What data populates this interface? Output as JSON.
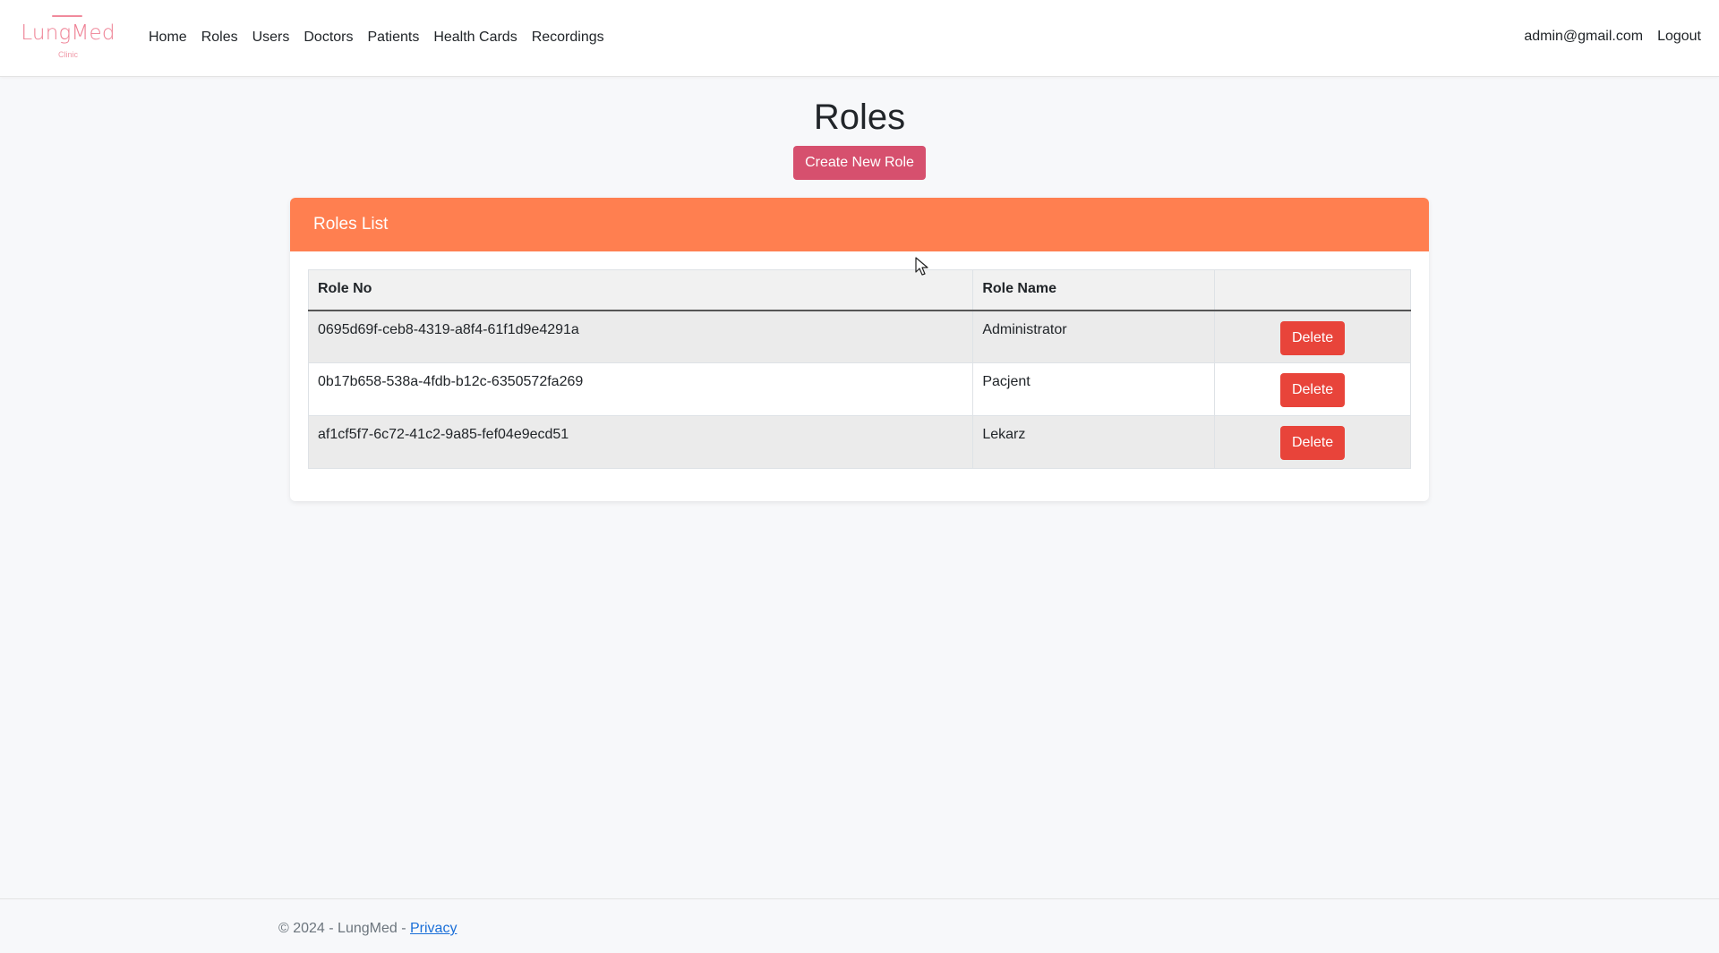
{
  "brand": {
    "name": "LungMed",
    "subtitle": "Clinic"
  },
  "nav": {
    "links": [
      "Home",
      "Roles",
      "Users",
      "Doctors",
      "Patients",
      "Health Cards",
      "Recordings"
    ],
    "user_email": "admin@gmail.com",
    "logout_label": "Logout"
  },
  "page": {
    "title": "Roles",
    "create_button": "Create New Role"
  },
  "roles_card": {
    "header": "Roles List",
    "columns": [
      "Role No",
      "Role Name",
      ""
    ],
    "rows": [
      {
        "id": "0695d69f-ceb8-4319-a8f4-61f1d9e4291a",
        "name": "Administrator",
        "action": "Delete"
      },
      {
        "id": "0b17b658-538a-4fdb-b12c-6350572fa269",
        "name": "Pacjent",
        "action": "Delete"
      },
      {
        "id": "af1cf5f7-6c72-41c2-9a85-fef04e9ecd51",
        "name": "Lekarz",
        "action": "Delete"
      }
    ]
  },
  "footer": {
    "copyright": "© 2024 - LungMed - ",
    "privacy_label": "Privacy"
  },
  "colors": {
    "brand": "#ee7f93",
    "create_button": "#d6506e",
    "card_header": "#ff7f50",
    "delete_button": "#e8443a",
    "link": "#1a6fd8"
  }
}
